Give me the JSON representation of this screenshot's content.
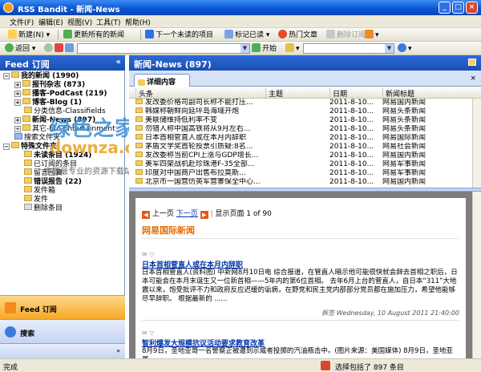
{
  "window": {
    "title": "RSS Bandit - 新闻-News",
    "minimize": "_",
    "maximize": "□",
    "close": "×"
  },
  "menu": [
    "文件(F)",
    "编辑(E)",
    "视图(V)",
    "工具(T)",
    "帮助(H)"
  ],
  "toolbar1": {
    "new": "新建(N)",
    "refresh_all": "更新所有的新闻",
    "next_unread": "下一个未读的项目",
    "mark_read": "标记已读",
    "hot_articles": "热门文章",
    "delete_feed": "删除订阅",
    "rss_label": "RSS"
  },
  "toolbar2": {
    "back": "返回",
    "start": "开始"
  },
  "left": {
    "header": "Feed 订阅",
    "collapse": "«",
    "tree": [
      {
        "label": "我的新闻 (1990)",
        "bold": true
      },
      {
        "label": "报刊杂志 (873)",
        "bold": true
      },
      {
        "label": "播客-PodCast (219)",
        "bold": true
      },
      {
        "label": "博客-Blog (1)",
        "bold": true
      },
      {
        "label": "分类信息-Classifields",
        "bold": false
      },
      {
        "label": "新闻-News (897)",
        "bold": true
      },
      {
        "label": "其它-Etc-Entertainment",
        "bold": false
      },
      {
        "label": "搜索文件夹",
        "bold": false
      },
      {
        "label": "特殊文件夹",
        "bold": true
      },
      {
        "label": "未读条目 (1924)",
        "bold": true
      },
      {
        "label": "已订阅的条目",
        "bold": false
      },
      {
        "label": "留言回复",
        "bold": false
      },
      {
        "label": "错误报告 (22)",
        "bold": true
      },
      {
        "label": "发件箱",
        "bold": false
      },
      {
        "label": "发件",
        "bold": false
      },
      {
        "label": "删除条目",
        "bold": false
      }
    ],
    "nav_feed": "Feed 订阅",
    "nav_search": "搜索"
  },
  "right": {
    "header": "新闻-News (897)",
    "tab": "详细内容",
    "columns": [
      "头条",
      "主题",
      "日期",
      "新闻标题"
    ],
    "rows": [
      [
        "发改委价格司副司长称不能打压...",
        "",
        "2011-8-10...",
        "网易国内新闻"
      ],
      [
        "韩媒称朝鲜向延坪岛海域开炮",
        "",
        "2011-8-10...",
        "网易头条新闻"
      ],
      [
        "美联储维持低利率不变",
        "",
        "2011-8-10...",
        "网易头条新闻"
      ],
      [
        "勿错人称中国高铁将从9月左右...",
        "",
        "2011-8-10...",
        "网易头条新闻"
      ],
      [
        "日本首相菅直人或在本月内辞职",
        "",
        "2011-8-10...",
        "网易国际新闻"
      ],
      [
        "茅盾文学奖首轮投票引质疑:8名...",
        "",
        "2011-8-10...",
        "网易社会新闻"
      ],
      [
        "发改委称当前CPI上涨与GDP增长...",
        "",
        "2011-8-10...",
        "网易国内新闻"
      ],
      [
        "美军四架战机赴珍珠港F-35全部...",
        "",
        "2011-8-10...",
        "网易军事新闻"
      ],
      [
        "印度对中国商户出售布拉莫斯...",
        "",
        "2011-8-10...",
        "网易军事新闻"
      ],
      [
        "北京市一国营仿英军营寨保全中心...",
        "",
        "2011-8-10...",
        "网易国内新闻"
      ]
    ],
    "reader": {
      "prev": "上一页",
      "next": "下一页",
      "page_info": "显示页面 1 of 90",
      "feed_title": "网易国际新闻",
      "items": [
        {
          "title": "日本首相菅直人或在本月内辞职",
          "body": "日本首相菅直人(资料图) 中新网8月10日电 综合报道，在管直人暗示他可能很快就会辞去首相之职后，日本可能会在本月末诞生又一位新首相——5年内的第6位首相。 去年6月上台的菅直人，自日本“311”大地震以来，饱受批评不力和政府反应迟缓的诟病，在野党和民主党内部部分党员都在施加压力，希望他能够尽早辞职。 根据最新的 ......",
          "meta": "拆签 Wednesday, 10 August 2011 21:40:00"
        },
        {
          "title": "智利爆发大规模抗议活动要求教育改革",
          "body": "8月9日，圣地亚哥一名警察正被遭到示威者投掷的汽油瓶击中。(图片来源：美国媒体) 8月9日，圣地亚哥",
          "meta": ""
        }
      ]
    }
  },
  "watermark": {
    "line1": "绿色之家",
    "line2": "downza.cn",
    "line3": "中国最专业的资源下载站"
  },
  "status": {
    "left": "完成",
    "right": "选择包括了 897 条目"
  },
  "colors": {
    "accent_blue": "#1a4fb3",
    "orange": "#f6a928",
    "link": "#0033aa"
  }
}
